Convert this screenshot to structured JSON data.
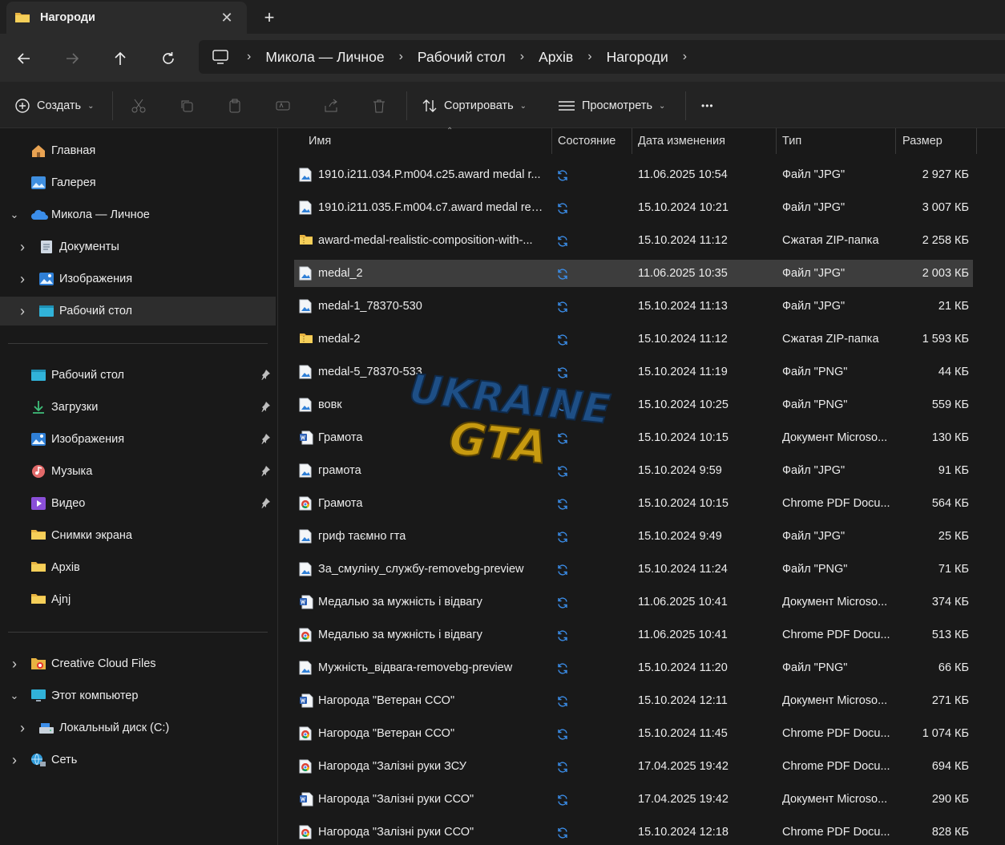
{
  "window": {
    "tab_title": "Нагороди",
    "close_glyph": "✕",
    "new_tab_glyph": "+"
  },
  "address": {
    "breadcrumbs": [
      "Микола — Личное",
      "Рабочий стол",
      "Архів",
      "Нагороди"
    ],
    "separator": "›"
  },
  "toolbar": {
    "create_label": "Создать",
    "sort_label": "Сортировать",
    "view_label": "Просмотреть",
    "more_glyph": "•••"
  },
  "sidebar": {
    "top": [
      {
        "label": "Главная",
        "icon": "home-icon"
      },
      {
        "label": "Галерея",
        "icon": "gallery-icon"
      },
      {
        "label": "Микола — Личное",
        "icon": "onedrive-icon",
        "expanded": true
      },
      {
        "label": "Документы",
        "icon": "documents-icon"
      },
      {
        "label": "Изображения",
        "icon": "pictures-icon"
      },
      {
        "label": "Рабочий стол",
        "icon": "desktop-icon",
        "selected": true
      }
    ],
    "quick": [
      {
        "label": "Рабочий стол",
        "icon": "desktop-icon",
        "pinned": true
      },
      {
        "label": "Загрузки",
        "icon": "downloads-icon",
        "pinned": true
      },
      {
        "label": "Изображения",
        "icon": "pictures-icon",
        "pinned": true
      },
      {
        "label": "Музыка",
        "icon": "music-icon",
        "pinned": true
      },
      {
        "label": "Видео",
        "icon": "video-icon",
        "pinned": true
      },
      {
        "label": "Снимки экрана",
        "icon": "folder-icon"
      },
      {
        "label": "Архів",
        "icon": "folder-icon"
      },
      {
        "label": "Ajnj",
        "icon": "folder-icon"
      }
    ],
    "bottom": [
      {
        "label": "Creative Cloud Files",
        "icon": "creative-cloud-icon"
      },
      {
        "label": "Этот компьютер",
        "icon": "computer-icon",
        "expanded": true
      },
      {
        "label": "Локальный диск (C:)",
        "icon": "disk-icon"
      },
      {
        "label": "Сеть",
        "icon": "network-icon"
      }
    ]
  },
  "columns": {
    "name": "Имя",
    "status": "Состояние",
    "date": "Дата изменения",
    "type": "Тип",
    "size": "Размер"
  },
  "files": [
    {
      "name": "1910.i211.034.P.m004.c25.award medal r...",
      "date": "11.06.2025 10:54",
      "type": "Файл \"JPG\"",
      "size": "2 927 КБ",
      "icon": "image-file-icon"
    },
    {
      "name": "1910.i211.035.F.m004.c7.award medal rea...",
      "date": "15.10.2024 10:21",
      "type": "Файл \"JPG\"",
      "size": "3 007 КБ",
      "icon": "image-file-icon"
    },
    {
      "name": "award-medal-realistic-composition-with-...",
      "date": "15.10.2024 11:12",
      "type": "Сжатая ZIP-папка",
      "size": "2 258 КБ",
      "icon": "zip-folder-icon"
    },
    {
      "name": "medal_2",
      "date": "11.06.2025 10:35",
      "type": "Файл \"JPG\"",
      "size": "2 003 КБ",
      "icon": "image-file-icon",
      "selected": true
    },
    {
      "name": "medal-1_78370-530",
      "date": "15.10.2024 11:13",
      "type": "Файл \"JPG\"",
      "size": "21 КБ",
      "icon": "image-file-icon"
    },
    {
      "name": "medal-2",
      "date": "15.10.2024 11:12",
      "type": "Сжатая ZIP-папка",
      "size": "1 593 КБ",
      "icon": "zip-folder-icon"
    },
    {
      "name": "medal-5_78370-533",
      "date": "15.10.2024 11:19",
      "type": "Файл \"PNG\"",
      "size": "44 КБ",
      "icon": "image-file-icon"
    },
    {
      "name": "вовк",
      "date": "15.10.2024 10:25",
      "type": "Файл \"PNG\"",
      "size": "559 КБ",
      "icon": "image-file-icon"
    },
    {
      "name": "Грамота",
      "date": "15.10.2024 10:15",
      "type": "Документ Microso...",
      "size": "130 КБ",
      "icon": "word-doc-icon"
    },
    {
      "name": "грамота",
      "date": "15.10.2024 9:59",
      "type": "Файл \"JPG\"",
      "size": "91 КБ",
      "icon": "image-file-icon"
    },
    {
      "name": "Грамота",
      "date": "15.10.2024 10:15",
      "type": "Chrome PDF Docu...",
      "size": "564 КБ",
      "icon": "chrome-pdf-icon"
    },
    {
      "name": "гриф таємно гта",
      "date": "15.10.2024 9:49",
      "type": "Файл \"JPG\"",
      "size": "25 КБ",
      "icon": "image-file-icon"
    },
    {
      "name": "За_смуліну_службу-removebg-preview",
      "date": "15.10.2024 11:24",
      "type": "Файл \"PNG\"",
      "size": "71 КБ",
      "icon": "image-file-icon"
    },
    {
      "name": "Медалью за мужність і відвагу",
      "date": "11.06.2025 10:41",
      "type": "Документ Microso...",
      "size": "374 КБ",
      "icon": "word-doc-icon"
    },
    {
      "name": "Медалью за мужність і відвагу",
      "date": "11.06.2025 10:41",
      "type": "Chrome PDF Docu...",
      "size": "513 КБ",
      "icon": "chrome-pdf-icon"
    },
    {
      "name": "Мужність_відвага-removebg-preview",
      "date": "15.10.2024 11:20",
      "type": "Файл \"PNG\"",
      "size": "66 КБ",
      "icon": "image-file-icon"
    },
    {
      "name": "Нагорода \"Ветеран ССО\"",
      "date": "15.10.2024 12:11",
      "type": "Документ Microso...",
      "size": "271 КБ",
      "icon": "word-doc-icon"
    },
    {
      "name": "Нагорода \"Ветеран ССО\"",
      "date": "15.10.2024 11:45",
      "type": "Chrome PDF Docu...",
      "size": "1 074 КБ",
      "icon": "chrome-pdf-icon"
    },
    {
      "name": "Нагорода \"Залізні руки ЗСУ",
      "date": "17.04.2025 19:42",
      "type": "Chrome PDF Docu...",
      "size": "694 КБ",
      "icon": "chrome-pdf-icon"
    },
    {
      "name": "Нагорода \"Залізні руки ССО\"",
      "date": "17.04.2025 19:42",
      "type": "Документ Microso...",
      "size": "290 КБ",
      "icon": "word-doc-icon"
    },
    {
      "name": "Нагорода \"Залізні руки ССО\"",
      "date": "15.10.2024 12:18",
      "type": "Chrome PDF Docu...",
      "size": "828 КБ",
      "icon": "chrome-pdf-icon"
    }
  ],
  "watermark": {
    "line1": "UKRAINE",
    "line2": "GTA"
  },
  "colors": {
    "accent": "#3b8eea",
    "folder": "#f2c94c",
    "selected_row": "#3d3d3d",
    "background": "#191919"
  }
}
